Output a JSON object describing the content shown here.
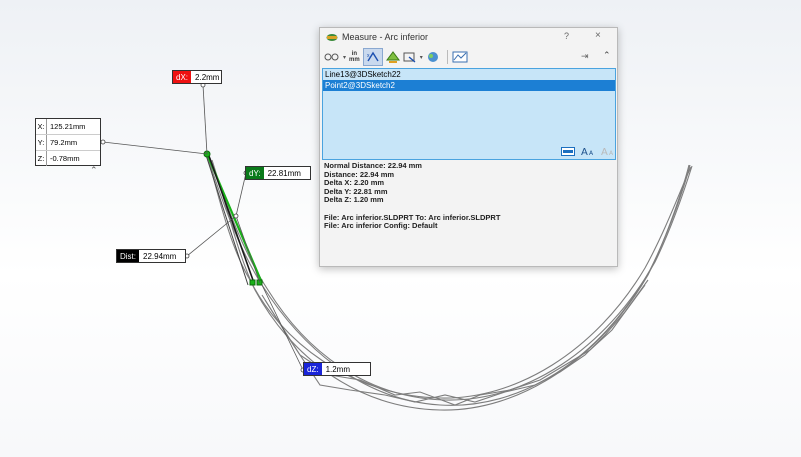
{
  "dialog": {
    "title": "Measure - Arc inferior",
    "help": "?",
    "close": "×",
    "toolbar": {
      "units_label_top": "in",
      "units_label_bottom": "mm"
    },
    "selections": [
      "Line13@3DSketch22",
      "Point2@3DSketch2"
    ],
    "results": {
      "normal_distance": "Normal Distance: 22.94 mm",
      "distance": "Distance: 22.94 mm",
      "delta_x": "Delta X: 2.20 mm",
      "delta_y": "Delta Y: 22.81 mm",
      "delta_z": "Delta Z: 1.20 mm",
      "file_line": "File: Arc inferior.SLDPRT To: Arc inferior.SLDPRT",
      "config_line": "File: Arc inferior Config: Default"
    }
  },
  "callouts": {
    "dx": {
      "tag": "dX:",
      "value": "2.2mm"
    },
    "dy": {
      "tag": "dY:",
      "value": "22.81mm"
    },
    "dist": {
      "tag": "Dist:",
      "value": "22.94mm"
    },
    "dz": {
      "tag": "dZ:",
      "value": "1.2mm"
    }
  },
  "coords": {
    "x_label": "X:",
    "x": "125.21mm",
    "y_label": "Y:",
    "y": "79.2mm",
    "z_label": "Z:",
    "z": "-0.78mm"
  },
  "colors": {
    "selection_green": "#19b219",
    "dx_tag": "#e11111",
    "dy_tag": "#0a7a1a",
    "dz_tag": "#1a25d8",
    "list_bg": "#c7e5f8",
    "list_active": "#1c7fd4"
  }
}
